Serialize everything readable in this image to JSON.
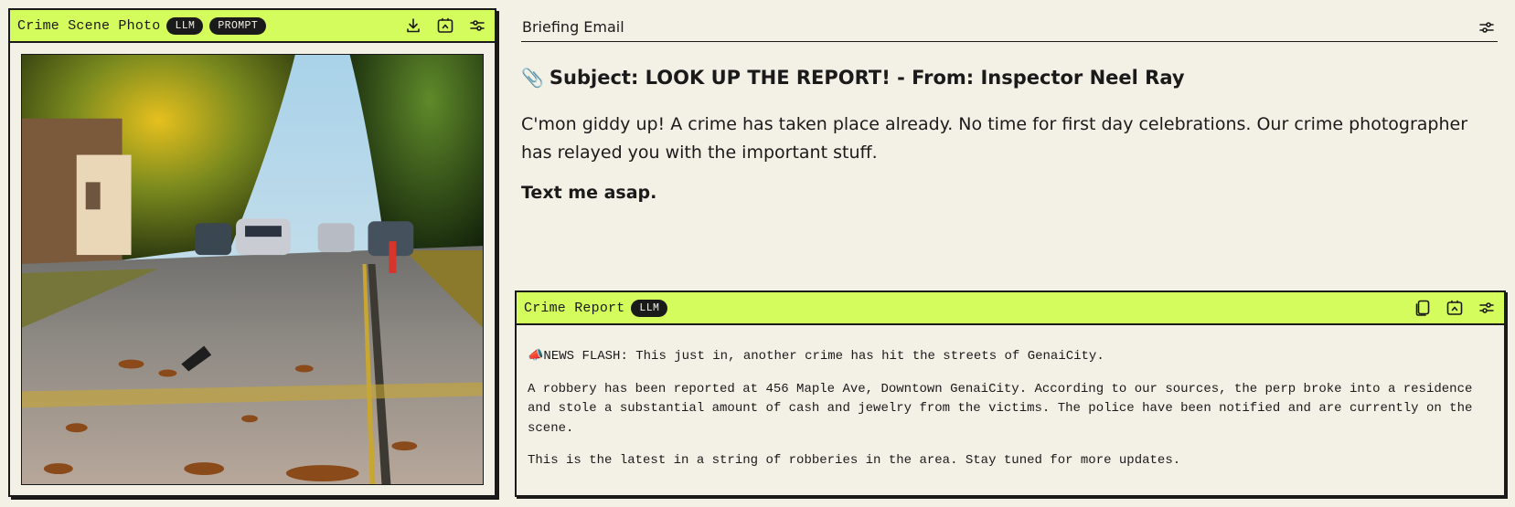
{
  "photo_panel": {
    "title": "Crime Scene Photo",
    "badges": [
      "LLM",
      "PROMPT"
    ],
    "icons": [
      "download-icon",
      "share-icon",
      "settings-sliders-icon"
    ]
  },
  "email": {
    "header": "Briefing Email",
    "subject_emoji": "📎",
    "subject": "Subject: LOOK UP THE REPORT! - From: Inspector Neel Ray",
    "body": "C'mon giddy up! A crime has taken place already. No time for first day celebrations. Our crime photographer has relayed you with the important stuff.",
    "closing": "Text me asap."
  },
  "report": {
    "title": "Crime Report",
    "badge": "LLM",
    "icons": [
      "copy-icon",
      "share-icon",
      "settings-sliders-icon"
    ],
    "paragraphs": [
      "📣NEWS FLASH: This just in, another crime has hit the streets of GenaiCity.",
      "A robbery has been reported at 456 Maple Ave, Downtown GenaiCity. According to our sources, the perp broke into a residence and stole a substantial amount of cash and jewelry from the victims. The police have been notified and are currently on the scene.",
      "This is the latest in a string of robberies in the area. Stay tuned for more updates."
    ]
  },
  "colors": {
    "accent": "#d4fc5c",
    "background": "#f3f0e6",
    "ink": "#1a1a1a"
  }
}
